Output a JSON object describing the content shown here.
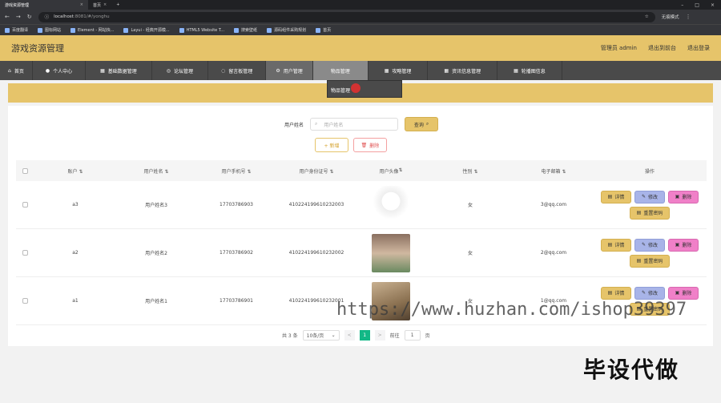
{
  "browser": {
    "tabs": [
      {
        "label": "游戏资源管理",
        "active": true
      },
      {
        "label": "首页",
        "active": false
      }
    ],
    "new_tab": "+",
    "url_host": "localhost",
    "url_rest": ":8081/#/yonghu",
    "profile": "无痕模式",
    "bookmarks": [
      "百度翻译",
      "图标网站",
      "Element - 网站快...",
      "Layui - 经典开源模...",
      "HTML5 Website T...",
      "搜索壁纸",
      "源码组件采购规划",
      "首页"
    ]
  },
  "app": {
    "title": "游戏资源管理",
    "admin": "管理员 admin",
    "to_front": "退出到前台",
    "logout": "退出登录"
  },
  "nav": [
    "首页",
    "个人中心",
    "基础数据管理",
    "论坛管理",
    "留言板管理",
    "用户管理",
    "物品管理",
    "攻略管理",
    "资讯信息管理",
    "轮播图信息"
  ],
  "dropdown_item": "物品管理",
  "search": {
    "label": "用户姓名",
    "placeholder": "用户姓名",
    "button": "查询"
  },
  "toolbar": {
    "add": "+ 新增",
    "delete": "删除"
  },
  "table": {
    "headers": [
      "账户",
      "用户姓名",
      "用户手机号",
      "用户身份证号",
      "用户头像",
      "性别",
      "电子邮箱",
      "操作"
    ],
    "rows": [
      {
        "account": "a3",
        "name": "用户姓名3",
        "phone": "17703786903",
        "idcard": "410224199610232003",
        "gender": "女",
        "email": "3@qq.com"
      },
      {
        "account": "a2",
        "name": "用户姓名2",
        "phone": "17703786902",
        "idcard": "410224199610232002",
        "gender": "女",
        "email": "2@qq.com"
      },
      {
        "account": "a1",
        "name": "用户姓名1",
        "phone": "17703786901",
        "idcard": "410224199610232001",
        "gender": "女",
        "email": "1@qq.com"
      }
    ],
    "ops": {
      "detail": "详情",
      "edit": "修改",
      "remove": "删除",
      "reset": "重置密码"
    }
  },
  "pager": {
    "total": "共 3 条",
    "size": "10条/页",
    "prev": "<",
    "page": "1",
    "next": ">",
    "goto": "前往",
    "goto_page": "1",
    "unit": "页"
  },
  "watermark": "https://www.huzhan.com/ishop39397",
  "stamp": "毕设代做"
}
